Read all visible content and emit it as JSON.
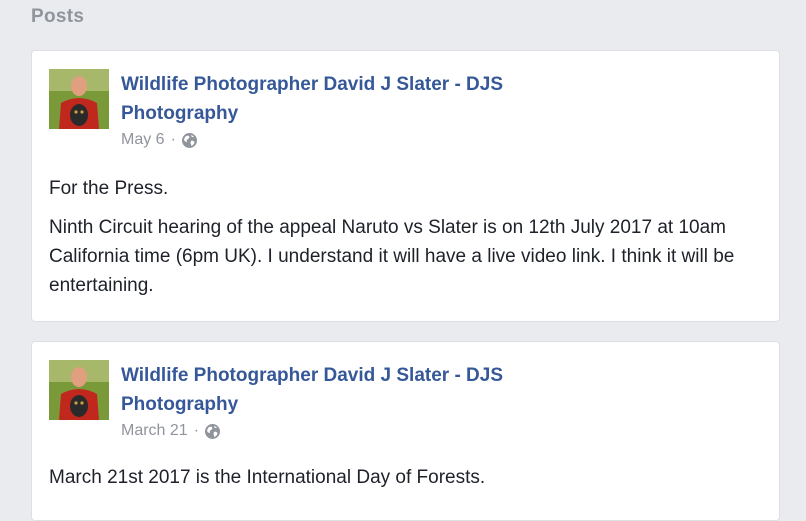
{
  "section": {
    "title": "Posts"
  },
  "posts": [
    {
      "author": "Wildlife Photographer David J Slater - DJS Photography",
      "date": "May 6",
      "separator": "·",
      "privacy_icon": "globe-icon",
      "paragraphs": [
        "For the Press.",
        "Ninth Circuit hearing of the appeal Naruto vs Slater is on 12th July 2017 at 10am California time (6pm UK). I understand it will have a live video link. I think it will be entertaining."
      ]
    },
    {
      "author": "Wildlife Photographer David J Slater - DJS Photography",
      "date": "March 21",
      "separator": "·",
      "privacy_icon": "globe-icon",
      "paragraphs": [
        "March 21st 2017 is the International Day of Forests."
      ]
    }
  ],
  "colors": {
    "background": "#e9ebee",
    "card": "#ffffff",
    "link": "#365899",
    "muted": "#90949c",
    "text": "#1d2129"
  }
}
